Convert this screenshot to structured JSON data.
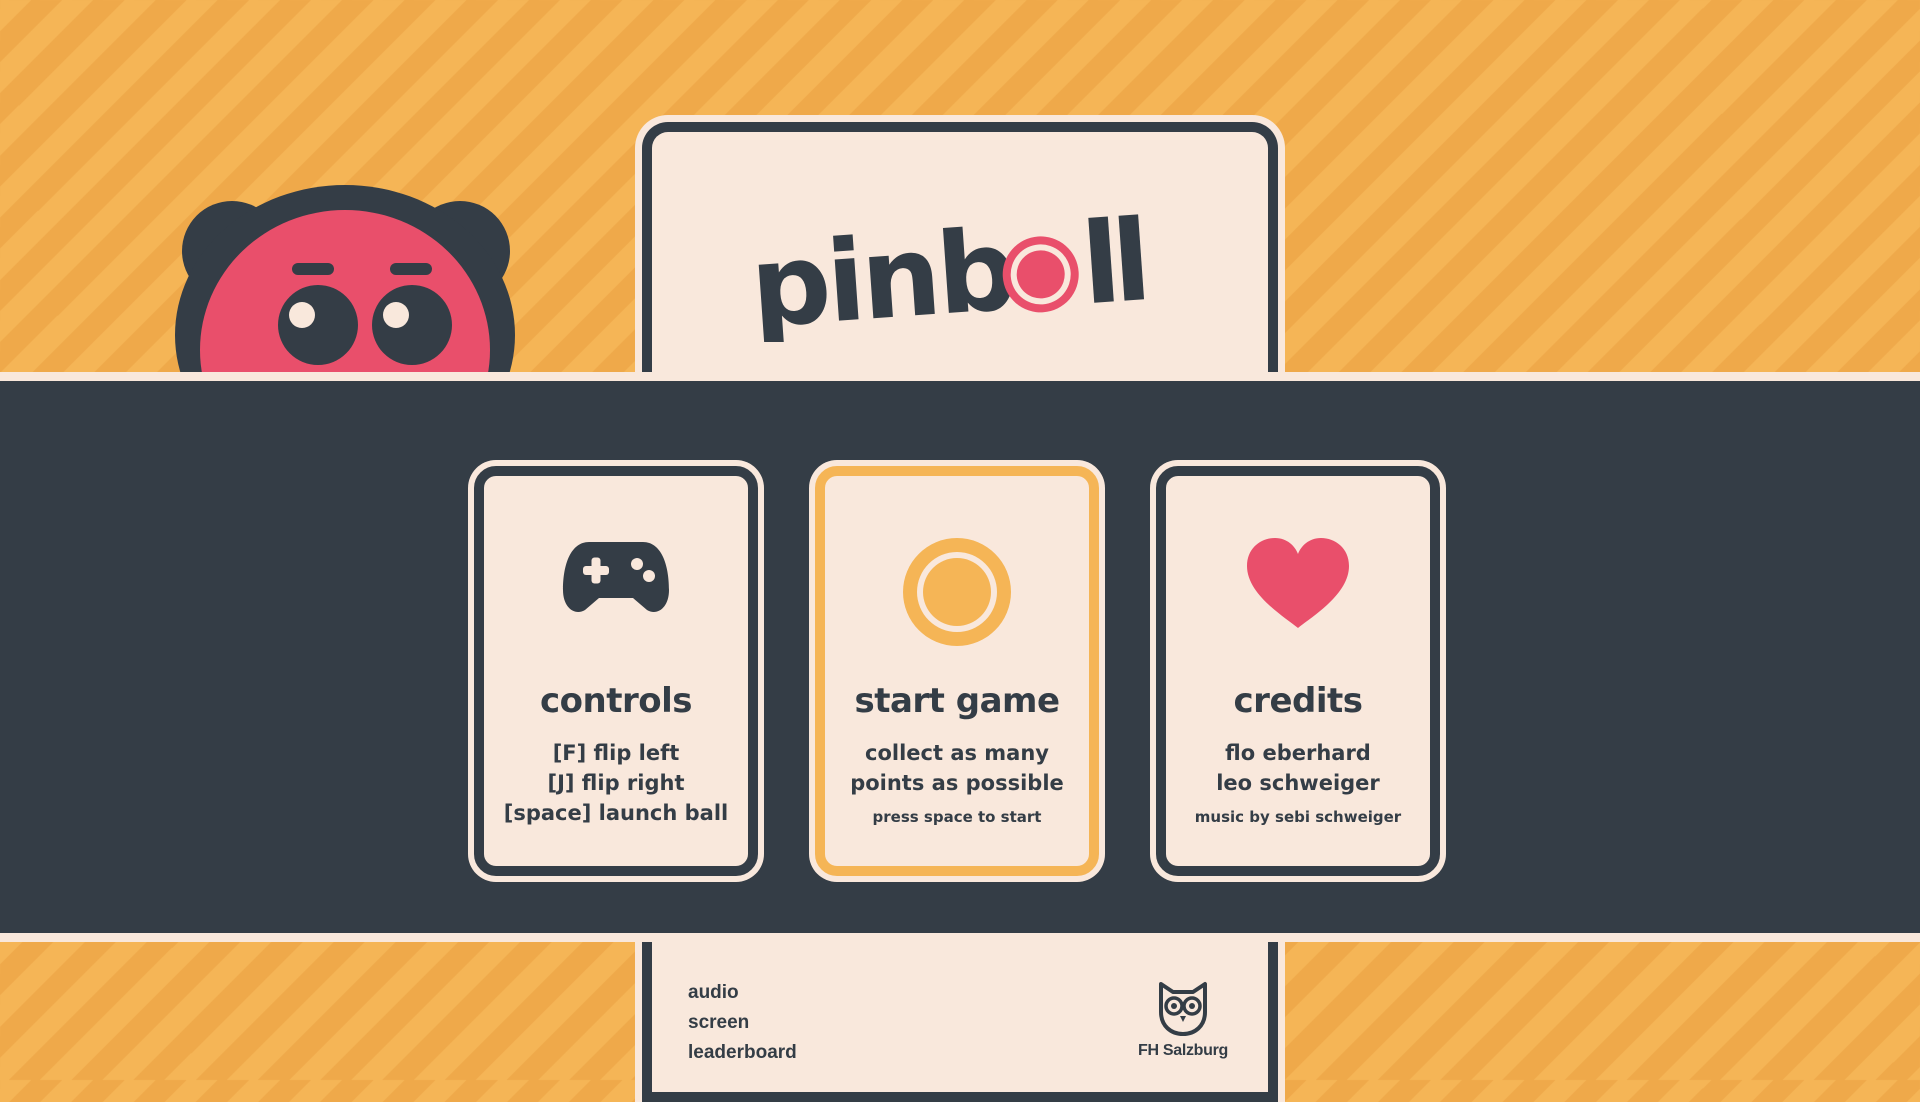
{
  "game": {
    "logo_text": "pinboll",
    "colors": {
      "orange": "#f5b556",
      "dark": "#343d46",
      "cream": "#f9e8dc",
      "pink": "#e94f6b"
    }
  },
  "mascot": {
    "icon": "bear-mascot-icon"
  },
  "cards": [
    {
      "icon": "gamepad-icon",
      "title": "controls",
      "lines": [
        "[F] flip left",
        "[J] flip right",
        "[space] launch ball"
      ]
    },
    {
      "icon": "coin-icon",
      "title": "start game",
      "lines": [
        "collect as many",
        "points as possible"
      ],
      "hint": "press space to start",
      "selected": true
    },
    {
      "icon": "heart-icon",
      "title": "credits",
      "lines": [
        "flo eberhard",
        "leo schweiger"
      ],
      "hint": "music by sebi schweiger"
    }
  ],
  "menu": [
    "audio",
    "screen",
    "leaderboard"
  ],
  "footer": {
    "university": "FH Salzburg",
    "icon": "owl-logo-icon"
  }
}
